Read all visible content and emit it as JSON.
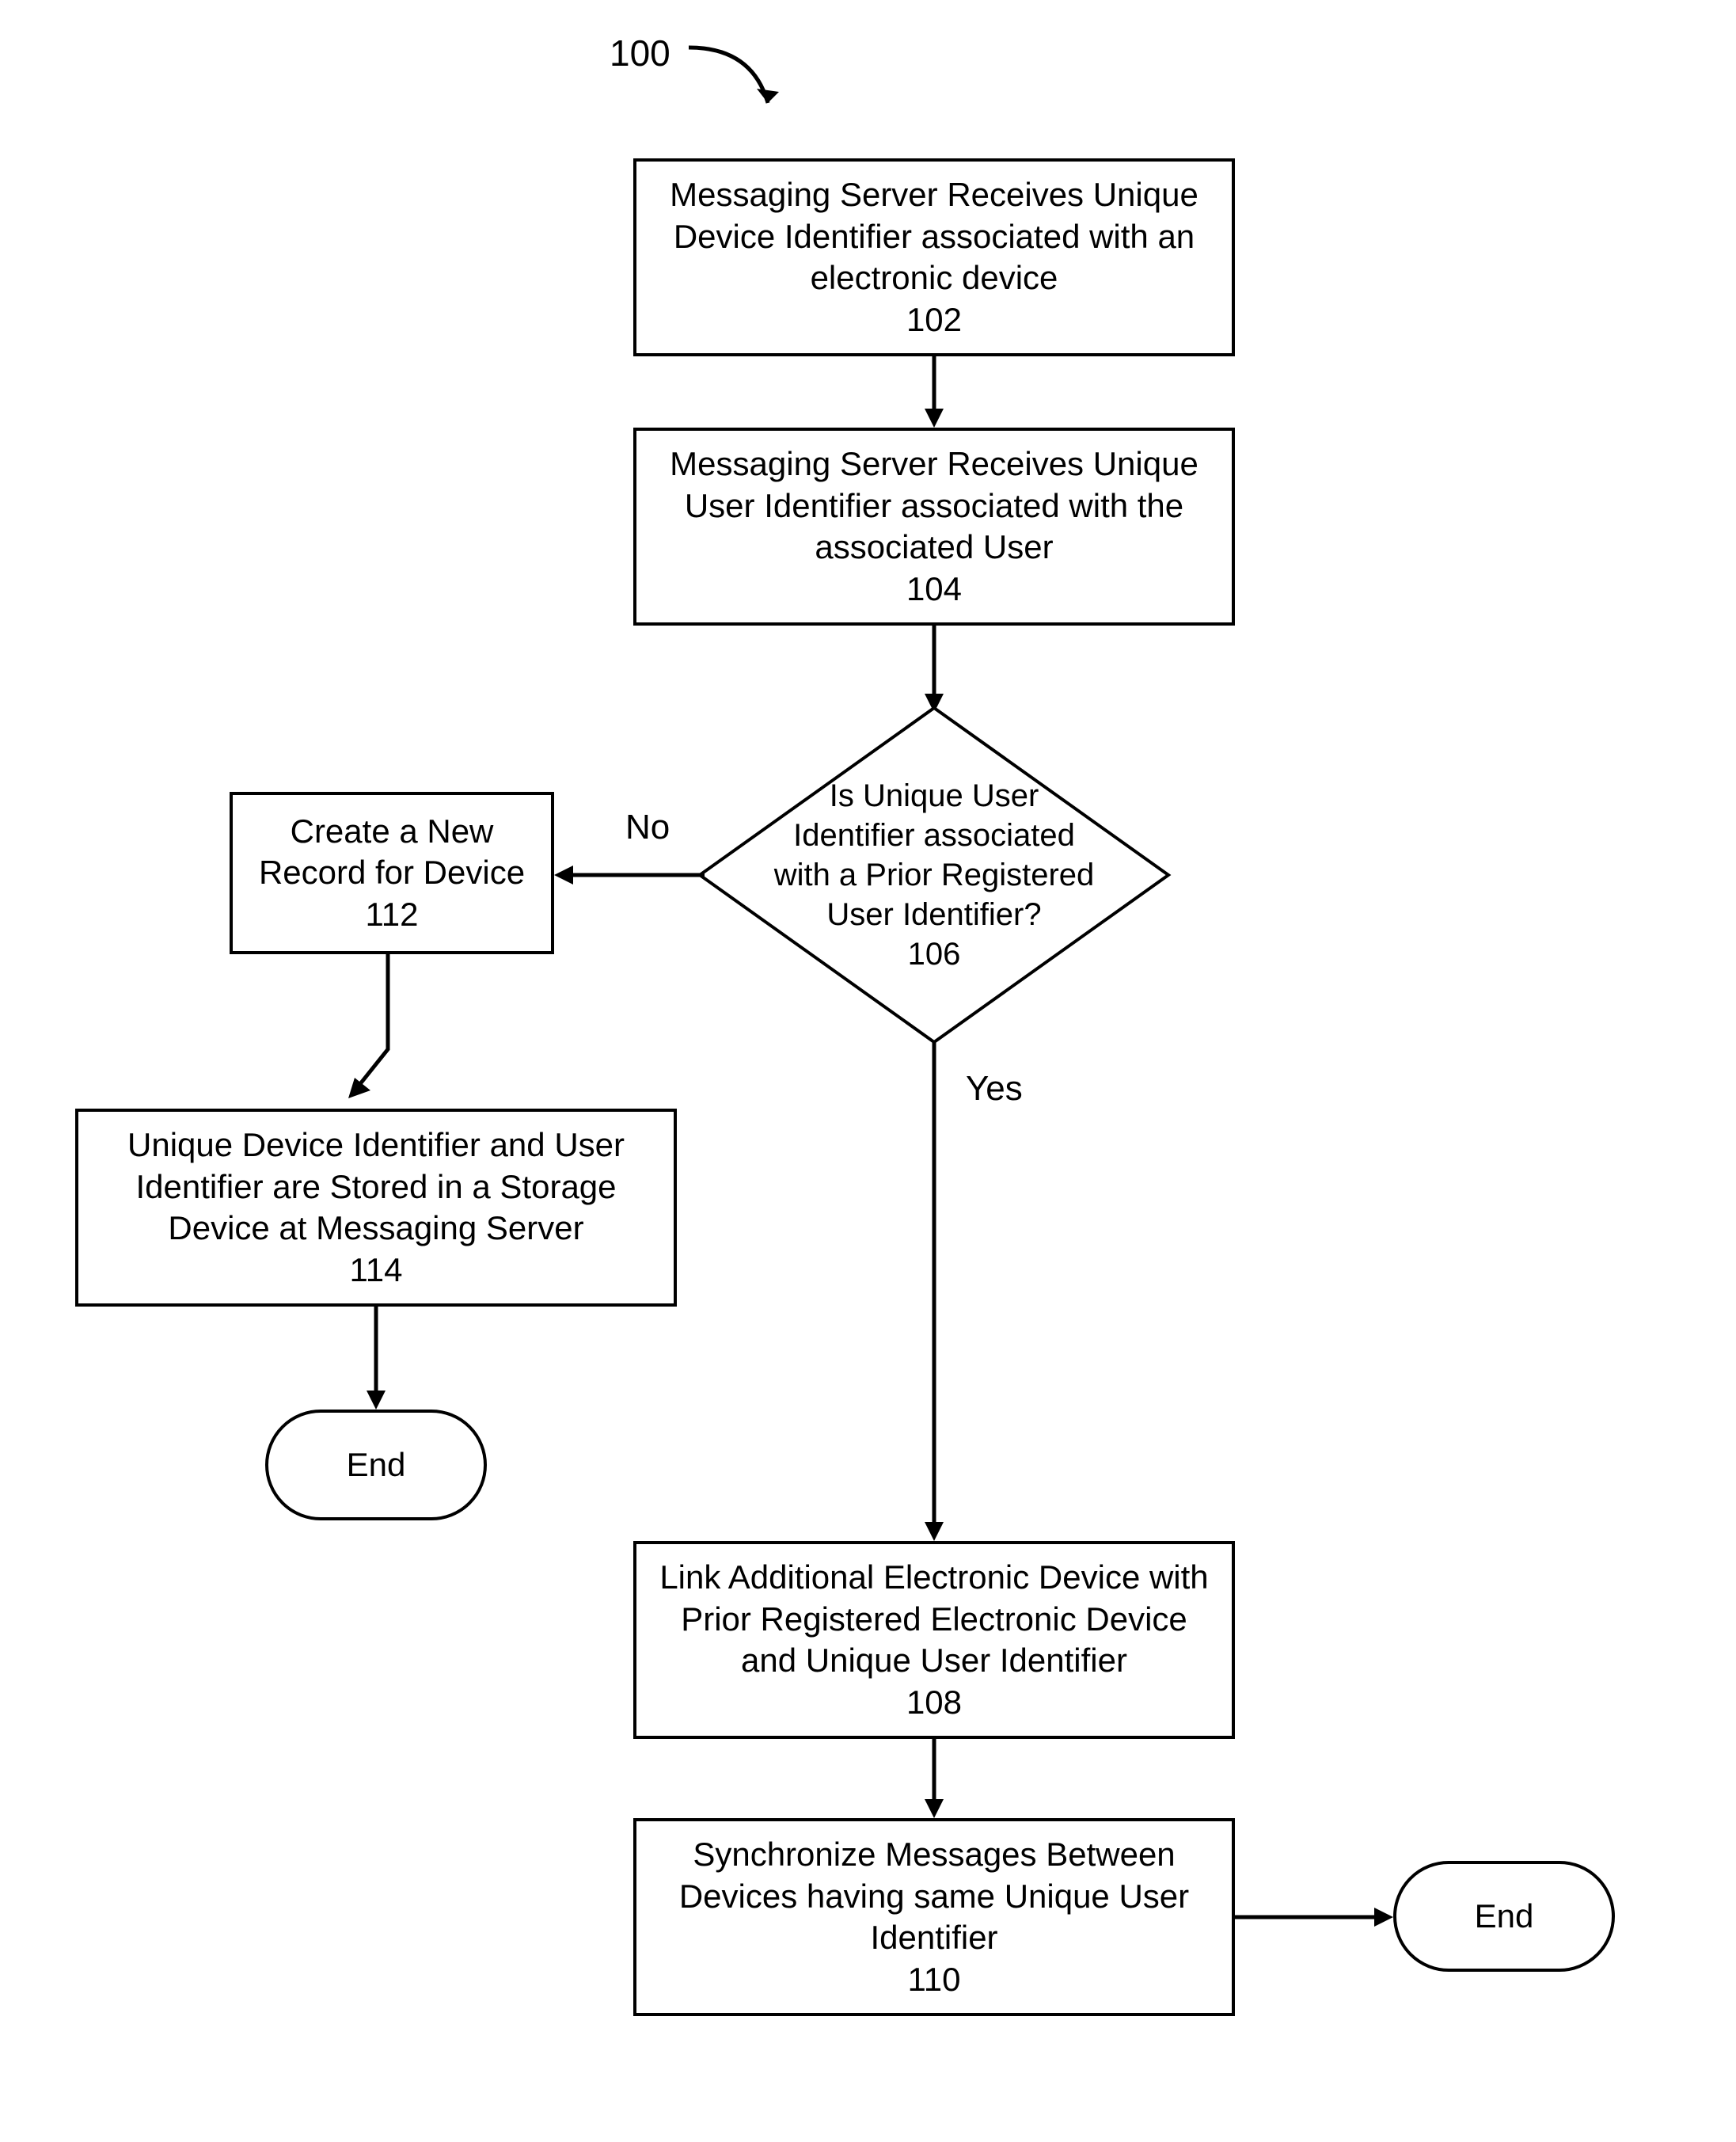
{
  "figure_label": "100",
  "nodes": {
    "n102": "Messaging Server Receives Unique Device Identifier associated with an  electronic device\n102",
    "n104": "Messaging Server Receives Unique User Identifier associated with the associated User\n104",
    "n106": "Is Unique User Identifier associated with a Prior Registered User Identifier?\n106",
    "n108": "Link Additional Electronic Device with Prior Registered Electronic Device and Unique User Identifier\n108",
    "n110": "Synchronize Messages Between Devices having same Unique User Identifier\n110",
    "n112": "Create a New Record for Device\n112",
    "n114": "Unique Device Identifier and User Identifier are Stored in a Storage Device at Messaging Server\n114",
    "end1": "End",
    "end2": "End"
  },
  "edges": {
    "no": "No",
    "yes": "Yes"
  },
  "chart_data": {
    "type": "flowchart",
    "nodes": [
      {
        "id": "102",
        "type": "process",
        "text": "Messaging Server Receives Unique Device Identifier associated with an electronic device"
      },
      {
        "id": "104",
        "type": "process",
        "text": "Messaging Server Receives Unique User Identifier associated with the associated User"
      },
      {
        "id": "106",
        "type": "decision",
        "text": "Is Unique User Identifier associated with a Prior Registered User Identifier?"
      },
      {
        "id": "108",
        "type": "process",
        "text": "Link Additional Electronic Device with Prior Registered Electronic Device and Unique User Identifier"
      },
      {
        "id": "110",
        "type": "process",
        "text": "Synchronize Messages Between Devices having same Unique User Identifier"
      },
      {
        "id": "112",
        "type": "process",
        "text": "Create a New Record for Device"
      },
      {
        "id": "114",
        "type": "process",
        "text": "Unique Device Identifier and User Identifier are Stored in a Storage Device at Messaging Server"
      },
      {
        "id": "end_left",
        "type": "terminator",
        "text": "End"
      },
      {
        "id": "end_right",
        "type": "terminator",
        "text": "End"
      }
    ],
    "edges": [
      {
        "from": "102",
        "to": "104"
      },
      {
        "from": "104",
        "to": "106"
      },
      {
        "from": "106",
        "to": "112",
        "label": "No"
      },
      {
        "from": "106",
        "to": "108",
        "label": "Yes"
      },
      {
        "from": "108",
        "to": "110"
      },
      {
        "from": "110",
        "to": "end_right"
      },
      {
        "from": "112",
        "to": "114"
      },
      {
        "from": "114",
        "to": "end_left"
      }
    ]
  }
}
